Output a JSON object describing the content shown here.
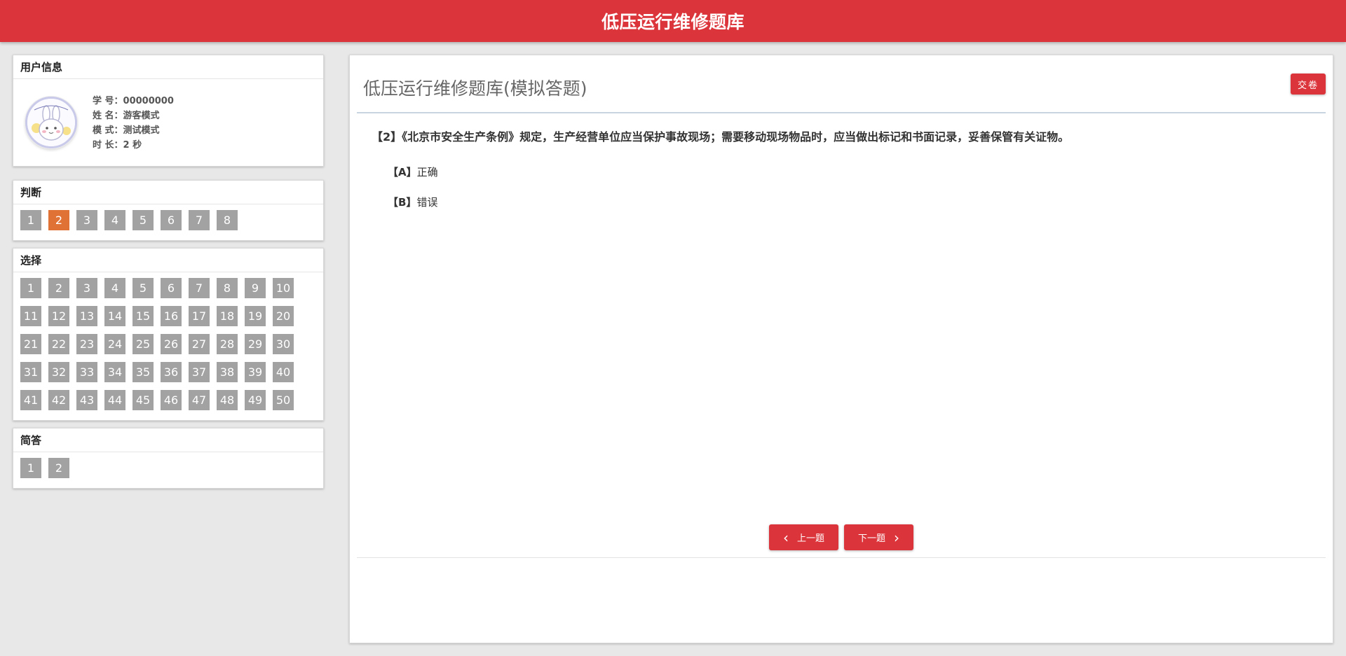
{
  "app_title": "低压运行维修题库",
  "user_panel": {
    "header": "用户信息",
    "fields": [
      {
        "label": "学 号：",
        "value": "00000000"
      },
      {
        "label": "姓 名：",
        "value": "游客模式"
      },
      {
        "label": "模 式：",
        "value": "测试模式"
      },
      {
        "label": "时 长：",
        "value": "2 秒"
      }
    ]
  },
  "sections": {
    "judge": {
      "header": "判断",
      "items": [
        "1",
        "2",
        "3",
        "4",
        "5",
        "6",
        "7",
        "8"
      ],
      "active": "2"
    },
    "choice": {
      "header": "选择",
      "items": [
        "1",
        "2",
        "3",
        "4",
        "5",
        "6",
        "7",
        "8",
        "9",
        "10",
        "11",
        "12",
        "13",
        "14",
        "15",
        "16",
        "17",
        "18",
        "19",
        "20",
        "21",
        "22",
        "23",
        "24",
        "25",
        "26",
        "27",
        "28",
        "29",
        "30",
        "31",
        "32",
        "33",
        "34",
        "35",
        "36",
        "37",
        "38",
        "39",
        "40",
        "41",
        "42",
        "43",
        "44",
        "45",
        "46",
        "47",
        "48",
        "49",
        "50"
      ]
    },
    "short": {
      "header": "简答",
      "items": [
        "1",
        "2"
      ]
    }
  },
  "main": {
    "title": "低压运行维修题库(模拟答题)",
    "submit_label": "交卷",
    "question": "【2】《北京市安全生产条例》规定，生产经营单位应当保护事故现场；需要移动现场物品时，应当做出标记和书面记录，妥善保管有关证物。",
    "options": [
      {
        "key": "【A】",
        "text": "正确"
      },
      {
        "key": "【B】",
        "text": "错误"
      }
    ],
    "prev_label": "上一题",
    "next_label": "下一题"
  },
  "colors": {
    "accent": "#dc343b",
    "active_question": "#e07235",
    "question_button": "#a2a2a2"
  }
}
